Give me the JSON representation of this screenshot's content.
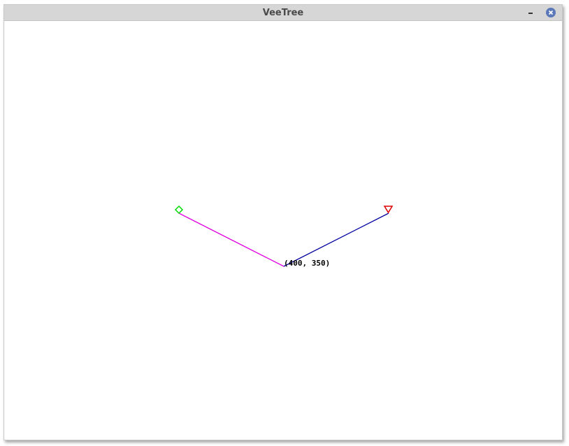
{
  "window": {
    "title": "VeeTree"
  },
  "canvas": {
    "vertex_label": "(400, 350)",
    "left_branch_color": "#e000e0",
    "right_branch_color": "#0000a0",
    "diamond_marker_color": "#00dd00",
    "triangle_marker_color": "#dd0000",
    "left_marker_icon": "diamond-icon",
    "right_marker_icon": "triangle-down-icon"
  }
}
